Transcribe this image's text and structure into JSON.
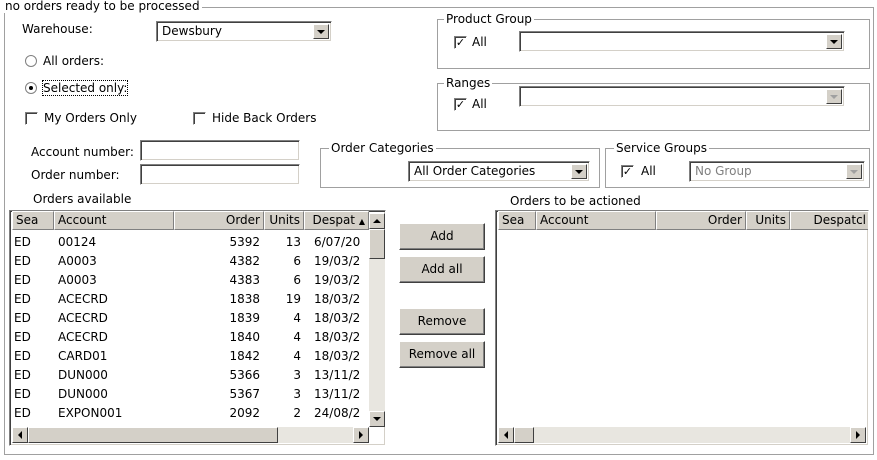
{
  "main_group": {
    "legend": "no orders ready to be processed"
  },
  "warehouse": {
    "label": "Warehouse:",
    "value": "Dewsbury"
  },
  "order_scope": {
    "all_label": "All orders:",
    "selected_label": "Selected only:",
    "selected": "selected"
  },
  "my_orders_only": {
    "label": "My Orders Only",
    "checked": false
  },
  "hide_back_orders": {
    "label": "Hide Back Orders",
    "checked": false
  },
  "product_group": {
    "legend": "Product Group",
    "all_label": "All",
    "all_checked": true,
    "value": ""
  },
  "ranges": {
    "legend": "Ranges",
    "all_label": "All",
    "all_checked": true,
    "value": ""
  },
  "account_number": {
    "label": "Account number:",
    "value": ""
  },
  "order_number": {
    "label": "Order number:",
    "value": ""
  },
  "order_categories": {
    "legend": "Order Categories",
    "value": "All Order Categories"
  },
  "service_groups": {
    "legend": "Service Groups",
    "all_label": "All",
    "all_checked": true,
    "value": "No Group"
  },
  "orders_available": {
    "label": "Orders available",
    "columns": [
      "Sea",
      "Account",
      "Order",
      "Units",
      "Despat"
    ],
    "rows": [
      [
        "ED",
        "00124",
        "5392",
        "13",
        "6/07/20"
      ],
      [
        "ED",
        "A0003",
        "4382",
        "6",
        "19/03/2"
      ],
      [
        "ED",
        "A0003",
        "4383",
        "6",
        "19/03/2"
      ],
      [
        "ED",
        "ACECRD",
        "1838",
        "19",
        "18/03/2"
      ],
      [
        "ED",
        "ACECRD",
        "1839",
        "4",
        "18/03/2"
      ],
      [
        "ED",
        "ACECRD",
        "1840",
        "4",
        "18/03/2"
      ],
      [
        "ED",
        "CARD01",
        "1842",
        "4",
        "18/03/2"
      ],
      [
        "ED",
        "DUN000",
        "5366",
        "3",
        "13/11/2"
      ],
      [
        "ED",
        "DUN000",
        "5367",
        "3",
        "13/11/2"
      ],
      [
        "ED",
        "EXPON001",
        "2092",
        "2",
        "24/08/2"
      ]
    ]
  },
  "actions": {
    "add": "Add",
    "add_all": "Add all",
    "remove": "Remove",
    "remove_all": "Remove all"
  },
  "orders_to_action": {
    "label": "Orders to be actioned",
    "columns": [
      "Sea",
      "Account",
      "Order",
      "Units",
      "Despatcl"
    ]
  },
  "colors": {
    "face": "#d4d0c8",
    "window": "#ffffff",
    "shadow": "#808080"
  }
}
